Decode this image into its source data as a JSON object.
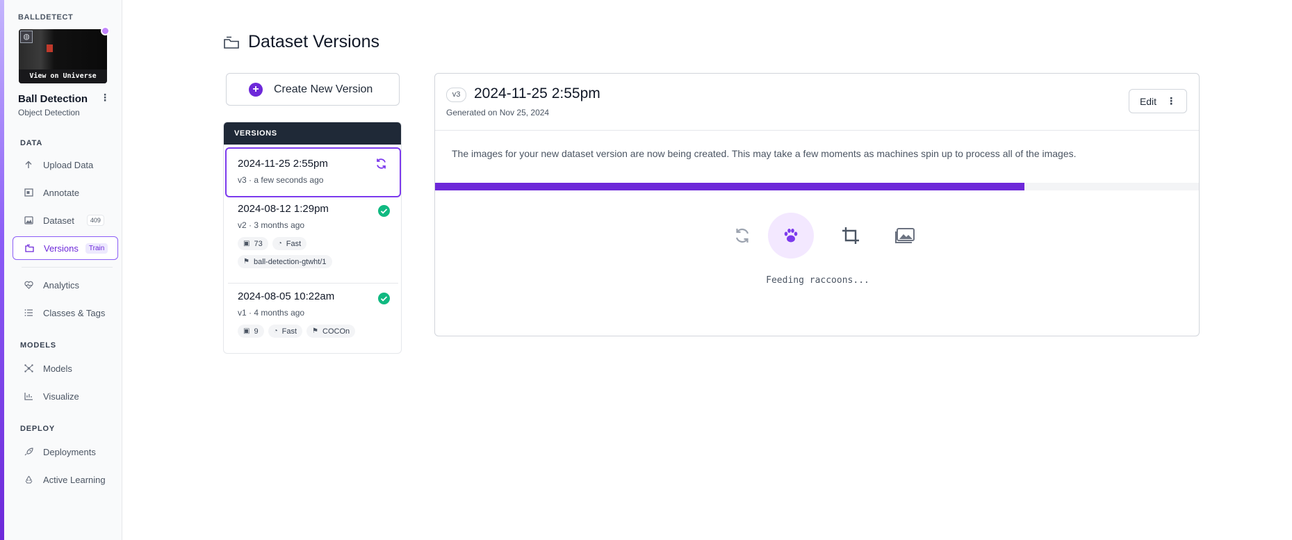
{
  "sidebar": {
    "workspace": "BALLDETECT",
    "thumbnail_label": "View on Universe",
    "project_name": "Ball Detection",
    "project_type": "Object Detection",
    "sections": {
      "data": "DATA",
      "models": "MODELS",
      "deploy": "DEPLOY"
    },
    "items": {
      "upload": "Upload Data",
      "annotate": "Annotate",
      "dataset": "Dataset",
      "dataset_count": "409",
      "versions": "Versions",
      "versions_badge": "Train",
      "analytics": "Analytics",
      "classes": "Classes & Tags",
      "models": "Models",
      "visualize": "Visualize",
      "deployments": "Deployments",
      "active_learning": "Active Learning"
    }
  },
  "main": {
    "title": "Dataset Versions",
    "create_button": "Create New Version",
    "versions_header": "VERSIONS",
    "versions": [
      {
        "title": "2024-11-25 2:55pm",
        "version": "v3",
        "age": "a few seconds ago",
        "status": "generating"
      },
      {
        "title": "2024-08-12 1:29pm",
        "version": "v2",
        "age": "3 months ago",
        "status": "done",
        "images": "73",
        "speed": "Fast",
        "tag": "ball-detection-gtwht/1"
      },
      {
        "title": "2024-08-05 10:22am",
        "version": "v1",
        "age": "4 months ago",
        "status": "done",
        "images": "9",
        "speed": "Fast",
        "tag": "COCOn"
      }
    ],
    "detail": {
      "tag": "v3",
      "title": "2024-11-25 2:55pm",
      "generated": "Generated on Nov 25, 2024",
      "edit_label": "Edit",
      "message": "The images for your new dataset version are now being created. This may take a few moments as machines spin up to process all of the images.",
      "progress": 0.77,
      "status_text": "Feeding raccoons...",
      "steps": [
        "refresh-icon",
        "paw-icon",
        "crop-icon",
        "images-icon"
      ],
      "current_step": 1
    }
  },
  "colors": {
    "accent": "#6d28d9",
    "accent_light": "#f3e8ff",
    "success": "#10b981",
    "header_dark": "#1f2937"
  }
}
